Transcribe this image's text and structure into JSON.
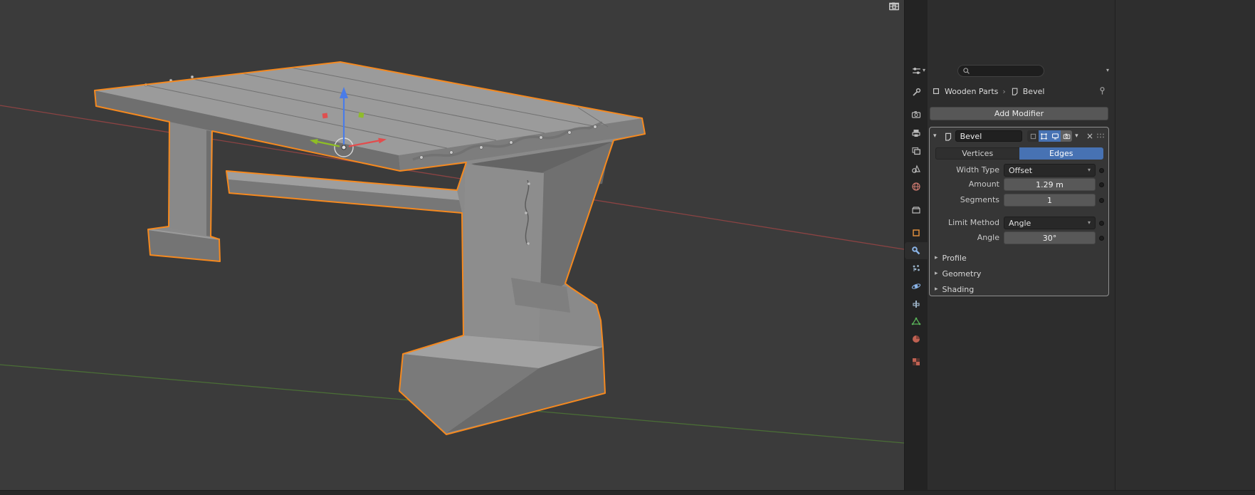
{
  "viewport": {
    "selection_outline_color": "#f5891f",
    "axis_x_color": "#a04545",
    "axis_y_color": "#4e7a35",
    "gizmo": {
      "x_color": "#e34c4c",
      "y_color": "#8ebe25",
      "z_color": "#4a7ce8"
    },
    "nav_icons": [
      {
        "name": "camera-view-icon"
      },
      {
        "name": "grid-ortho-icon"
      }
    ]
  },
  "properties": {
    "header": {
      "search_placeholder": "",
      "search_value": ""
    },
    "breadcrumb": {
      "object_name": "Wooden Parts",
      "separator": "›",
      "modifier_name": "Bevel"
    },
    "add_modifier_label": "Add Modifier",
    "modifier": {
      "name": "Bevel",
      "affect": {
        "vertices": "Vertices",
        "edges": "Edges",
        "selected": "Edges"
      },
      "fields": {
        "width_type": {
          "label": "Width Type",
          "value": "Offset"
        },
        "amount": {
          "label": "Amount",
          "value": "1.29 m"
        },
        "segments": {
          "label": "Segments",
          "value": "1"
        },
        "limit_method": {
          "label": "Limit Method",
          "value": "Angle"
        },
        "angle": {
          "label": "Angle",
          "value": "30°"
        }
      },
      "sections": {
        "profile": "Profile",
        "geometry": "Geometry",
        "shading": "Shading"
      }
    },
    "tabs": [
      {
        "name": "tool"
      },
      {
        "name": "render"
      },
      {
        "name": "output"
      },
      {
        "name": "view-layer"
      },
      {
        "name": "scene"
      },
      {
        "name": "world"
      },
      {
        "name": "collection"
      },
      {
        "name": "object"
      },
      {
        "name": "modifiers",
        "active": true
      },
      {
        "name": "particles"
      },
      {
        "name": "physics"
      },
      {
        "name": "constraints"
      },
      {
        "name": "object-data"
      },
      {
        "name": "material"
      },
      {
        "name": "texture"
      }
    ]
  },
  "colors": {
    "accent_blue": "#4772b3",
    "selection_orange": "#f5891f"
  }
}
